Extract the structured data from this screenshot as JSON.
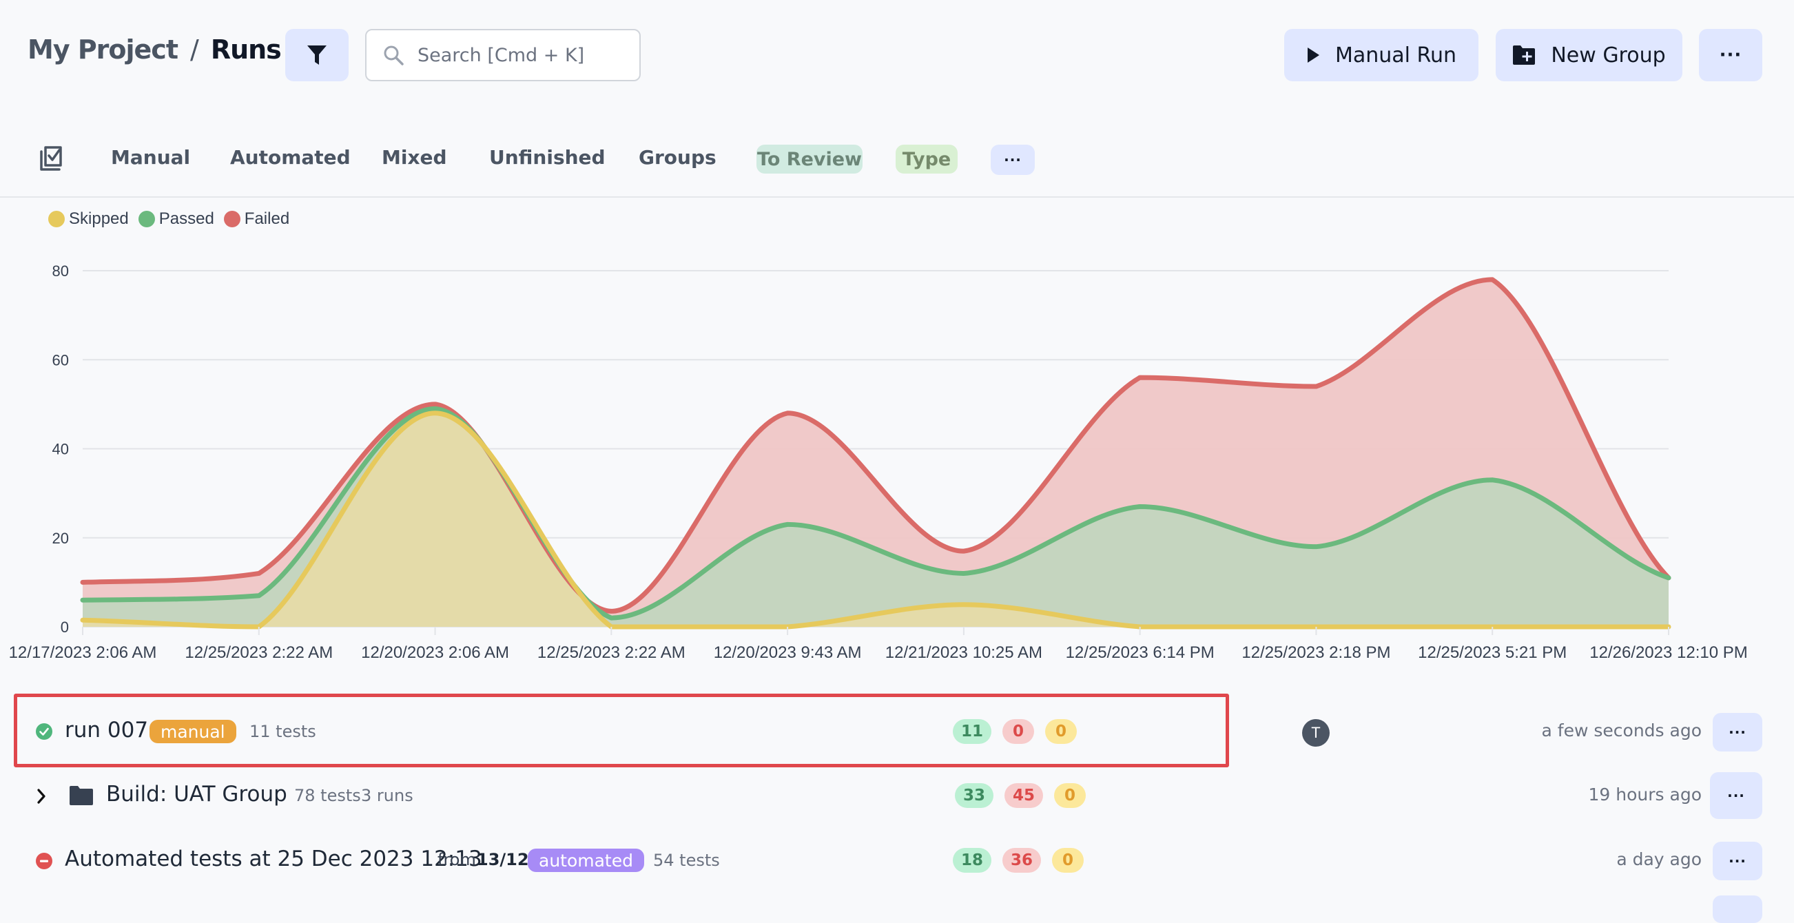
{
  "header": {
    "project": "My Project",
    "separator": "/",
    "page": "Runs",
    "search_placeholder": "Search [Cmd + K]",
    "manual_run_label": "Manual Run",
    "new_group_label": "New Group",
    "more_label": "···"
  },
  "tabs": {
    "items": [
      "Manual",
      "Automated",
      "Mixed",
      "Unfinished",
      "Groups"
    ],
    "chips": {
      "to_review": "To Review",
      "type": "Type",
      "more": "···"
    }
  },
  "chart_data": {
    "type": "area",
    "stacked": true,
    "smooth": true,
    "title": "",
    "xlabel": "",
    "ylabel": "",
    "ylim": [
      0,
      80
    ],
    "yticks": [
      0,
      20,
      40,
      60,
      80
    ],
    "grid": true,
    "legend_position": "top-left",
    "categories": [
      "12/17/2023 2:06 AM",
      "12/25/2023 2:22 AM",
      "12/20/2023 2:06 AM",
      "12/25/2023 2:22 AM",
      "12/20/2023 9:43 AM",
      "12/21/2023 10:25 AM",
      "12/25/2023 6:14 PM",
      "12/25/2023 2:18 PM",
      "12/25/2023 5:21 PM",
      "12/26/2023 12:10 PM"
    ],
    "series": [
      {
        "name": "Skipped",
        "color": "#e6c95c",
        "values": [
          1.5,
          0,
          48,
          0,
          0,
          5,
          0,
          0,
          0,
          0
        ]
      },
      {
        "name": "Passed",
        "color": "#6bb97e",
        "values": [
          4.5,
          7,
          1,
          2,
          23,
          7,
          27,
          18,
          33,
          11
        ]
      },
      {
        "name": "Failed",
        "color": "#da6b68",
        "values": [
          4,
          5,
          1,
          1.5,
          25,
          5,
          29,
          36,
          45,
          0
        ]
      }
    ]
  },
  "runs": [
    {
      "status": "passed",
      "title": "run 007",
      "tag": "manual",
      "tests": "11 tests",
      "passed": "11",
      "failed": "0",
      "skipped": "0",
      "avatar": "T",
      "time": "a few seconds ago",
      "more": "···"
    },
    {
      "type": "group",
      "title": "Build: UAT Group",
      "tests": "78 tests",
      "runs": "3 runs",
      "passed": "33",
      "failed": "45",
      "skipped": "0",
      "time": "19 hours ago",
      "more": "···"
    },
    {
      "status": "failed",
      "title": "Automated tests at 25 Dec 2023 12:13",
      "from_label": "from",
      "from_value": "13/12",
      "tag": "automated",
      "tests": "54 tests",
      "passed": "18",
      "failed": "36",
      "skipped": "0",
      "time": "a day ago",
      "more": "···"
    }
  ],
  "colors": {
    "accent_bg": "#e0e7ff",
    "manual_tag": "#eba43c",
    "automated_tag": "#a78bf6",
    "highlight": "#e0474c"
  }
}
